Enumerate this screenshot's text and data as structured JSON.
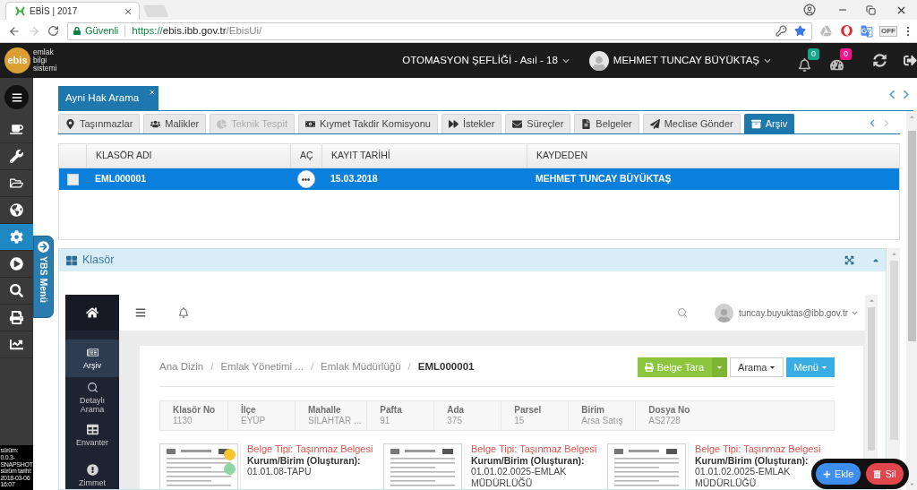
{
  "browser": {
    "tab": {
      "title": "EBİS | 2017"
    },
    "address_bar": {
      "security_label": "Güvenli",
      "url": {
        "scheme": "https://",
        "host": "ebis.ibb.gov.tr",
        "path": "/EbisUi/"
      }
    },
    "extension_label": "OFF"
  },
  "app_header": {
    "logo": {
      "mark": "ebis",
      "lines": [
        "emlak",
        "bilgi",
        "sistemi"
      ]
    },
    "unit": "OTOMASYON ŞEFLİĞİ - Asıl - 18",
    "user": "MEHMET TUNCAY BÜYÜKTAŞ",
    "indicators": [
      {
        "kind": "notifications",
        "count": "0",
        "color": "#17a589"
      },
      {
        "kind": "tasks",
        "count": "0",
        "color": "#f0168a"
      }
    ]
  },
  "sidebar": {
    "items": [
      {
        "selected": false
      },
      {
        "selected": false
      },
      {
        "selected": false
      },
      {
        "selected": false
      },
      {
        "selected": true
      },
      {
        "selected": false
      },
      {
        "selected": false
      },
      {
        "selected": false
      },
      {
        "selected": false
      }
    ],
    "side_tab": "YBS Menü",
    "version": {
      "label": "sürüm:",
      "value": "0.0.3-SNAPSHOT",
      "date_label": "sürüm tarihi:",
      "date": "2018-03-06 16:07"
    }
  },
  "page_tabs": [
    {
      "label": "Ayni Hak Arama",
      "selected": true
    }
  ],
  "section_tabs": [
    {
      "label": "Taşınmazlar",
      "selected": false,
      "disabled": false
    },
    {
      "label": "Malikler",
      "selected": false,
      "disabled": false
    },
    {
      "label": "Teknik Tespit",
      "selected": false,
      "disabled": true
    },
    {
      "label": "Kıymet Takdir Komisyonu",
      "selected": false,
      "disabled": false
    },
    {
      "label": "İstekler",
      "selected": false,
      "disabled": false
    },
    {
      "label": "Süreçler",
      "selected": false,
      "disabled": false
    },
    {
      "label": "Belgeler",
      "selected": false,
      "disabled": false
    },
    {
      "label": "Meclise Gönder",
      "selected": false,
      "disabled": false
    },
    {
      "label": "Arşiv",
      "selected": true,
      "disabled": false
    }
  ],
  "table": {
    "columns": [
      {
        "label": "KLASÖR ADI"
      },
      {
        "label": "AÇ"
      },
      {
        "label": "KAYIT TARİHİ"
      },
      {
        "label": "KAYDEDEN"
      }
    ],
    "rows": [
      {
        "selected": true,
        "checked": false,
        "klasor_adi": "EML000001",
        "kayit_tarihi": "15.03.2018",
        "kaydeden": "MEHMET TUNCAY BÜYÜKTAŞ"
      }
    ]
  },
  "panel": {
    "title": "Klasör"
  },
  "archive_app": {
    "nav": [
      {
        "label": "Arşiv",
        "selected": true
      },
      {
        "label": "Detaylı Arama",
        "selected": false
      },
      {
        "label": "Envanter",
        "selected": false
      },
      {
        "label": "Zimmet",
        "selected": false
      }
    ],
    "user_email": "tuncay.buyuktas@ibb.gov.tr",
    "breadcrumb": {
      "separator": "/",
      "items": [
        {
          "label": "Ana Dizin",
          "current": false
        },
        {
          "label": "Emlak Yönetimi ...",
          "current": false
        },
        {
          "label": "Emlak Müdürlüğü",
          "current": false
        },
        {
          "label": "EML000001",
          "current": true
        }
      ]
    },
    "actions": [
      {
        "kind": "split",
        "label": "Belge Tara"
      },
      {
        "kind": "dropdown",
        "label": "Arama"
      },
      {
        "kind": "primary-dropdown",
        "label": "Menü"
      }
    ],
    "details": [
      {
        "label": "Klasör No",
        "value": "1130"
      },
      {
        "label": "İlçe",
        "value": "EYÜP"
      },
      {
        "label": "Mahalle",
        "value": "SİLAHTAR ..."
      },
      {
        "label": "Pafta",
        "value": "91"
      },
      {
        "label": "Ada",
        "value": "375"
      },
      {
        "label": "Parsel",
        "value": "15"
      },
      {
        "label": "Birim",
        "value": "Arsa Satış"
      },
      {
        "label": "Dosya No",
        "value": "AS2728"
      }
    ],
    "documents": [
      {
        "type": "Belge Tipi: Taşınmaz Belgesi",
        "org_label": "Kurum/Birim (Oluşturan):",
        "org": "01.01.08-TAPU",
        "dots": [
          {
            "color": "#f7c52f"
          },
          {
            "color": "#8fd6a4"
          }
        ]
      },
      {
        "type": "Belge Tipi: Taşınmaz Belgesi",
        "org_label": "Kurum/Birim (Oluşturan):",
        "org": "01.01.02.0025-EMLAK MÜDÜRLÜĞÜ"
      },
      {
        "type": "Belge Tipi: Taşınmaz Belgesi",
        "org_label": "Kurum/Birim (Oluşturan):",
        "org": "01.01.02.0025-EMLAK MÜDÜRLÜĞÜ"
      }
    ]
  },
  "floating_actions": [
    {
      "kind": "add",
      "label": "Ekle"
    },
    {
      "kind": "delete",
      "label": "Sil"
    }
  ]
}
